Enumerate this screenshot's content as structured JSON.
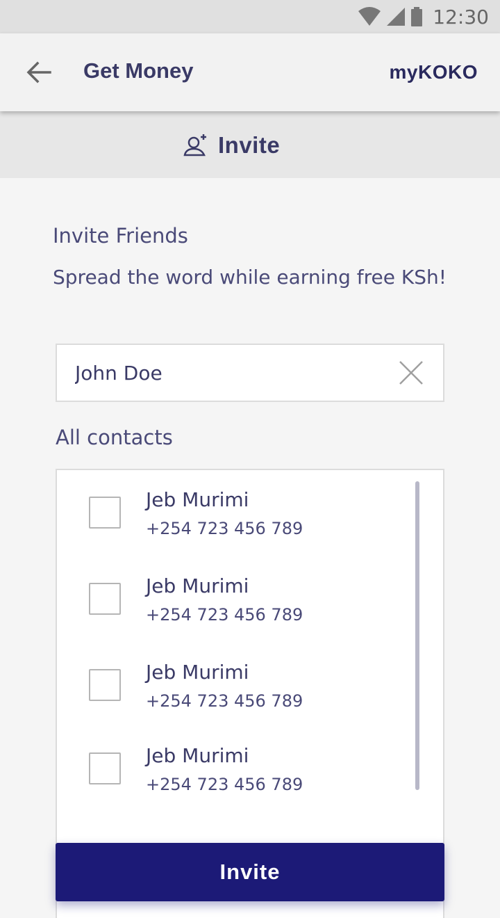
{
  "status_bar": {
    "time": "12:30"
  },
  "app_bar": {
    "title": "Get Money",
    "brand": "myKOKO"
  },
  "tab": {
    "label": "Invite"
  },
  "intro": {
    "title": "Invite Friends",
    "subtitle": "Spread the word while earning free KSh!"
  },
  "search": {
    "value": "John Doe"
  },
  "contacts": {
    "label": "All contacts",
    "items": [
      {
        "name": "Jeb Murimi",
        "phone": "+254 723 456 789",
        "checked": false
      },
      {
        "name": "Jeb Murimi",
        "phone": "+254 723 456 789",
        "checked": false
      },
      {
        "name": "Jeb Murimi",
        "phone": "+254 723 456 789",
        "checked": false
      },
      {
        "name": "Jeb Murimi",
        "phone": "+254 723 456 789",
        "checked": false
      }
    ]
  },
  "invite_button": {
    "label": "Invite"
  },
  "colors": {
    "primary": "#1c1a77",
    "text": "#3a3a66"
  }
}
